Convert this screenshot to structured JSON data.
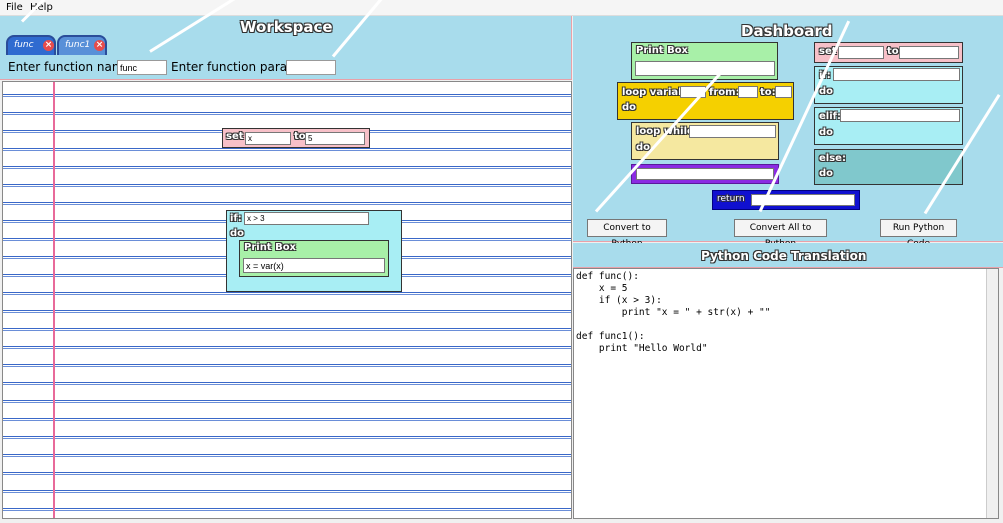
{
  "menu": {
    "file": "File",
    "help": "Help"
  },
  "workspace": {
    "title": "Workspace",
    "tabs": [
      {
        "label": "func"
      },
      {
        "label": "func1"
      }
    ],
    "function_name_label": "Enter function name:",
    "function_name_value": "func",
    "function_params_label": "Enter function params:",
    "function_params_value": "",
    "blocks": {
      "set": {
        "label": "set",
        "var": "x",
        "to_label": "to",
        "value": "5"
      },
      "if": {
        "label": "if:",
        "condition": "x > 3",
        "do_label": "do",
        "print": {
          "label": "Print Box",
          "value": "x = var(x)"
        }
      }
    }
  },
  "dashboard": {
    "title": "Dashboard",
    "print_box": "Print Box",
    "loop_variable": "loop variable",
    "from": "from:",
    "to": "to:",
    "do": "do",
    "loop_while": "loop while:",
    "set": "set",
    "set_to": "to",
    "if": "if:",
    "elif": "elif:",
    "else": "else:",
    "return": "return",
    "buttons": {
      "convert": "Convert to Python",
      "convert_all": "Convert All to Python",
      "run": "Run Python Code"
    }
  },
  "code": {
    "title": "Python Code Translation",
    "lines": [
      "def func():",
      "    x = 5",
      "    if (x > 3):",
      "        print \"x = \" + str(x) + \"\"",
      "",
      "def func1():",
      "    print \"Hello World\""
    ]
  },
  "colors": {
    "panel_bg": "#a8dcec",
    "set_block": "#f7c0c8",
    "if_block": "#a8eef4",
    "print_block": "#a8f0a8",
    "loop_block": "#f5d000",
    "while_block": "#f5e8a0",
    "else_block": "#80c8cc",
    "purple_block": "#8a2be2",
    "return_block": "#1010d0",
    "tab_active": "#2f6bd0"
  }
}
